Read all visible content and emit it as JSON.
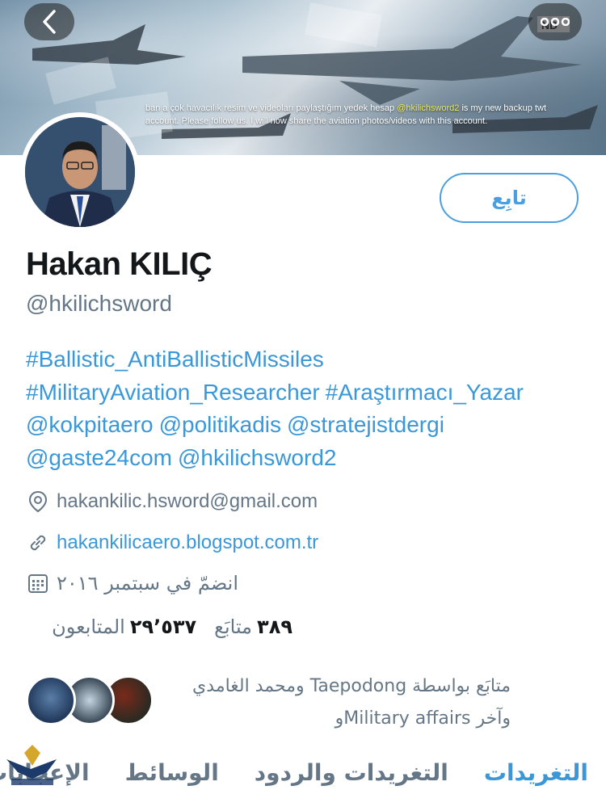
{
  "banner": {
    "text_part1": "ban a çok havacılık resim ve videoları paylaştığım yedek hesap ",
    "text_handle": "@hkilichsword2",
    "text_part2": " is my new backup twt account. Please follow us. I will now share the aviation photos/videos with this account.",
    "plate": "ND"
  },
  "nav": {
    "back_icon": "chevron-left-icon",
    "more_icon": "more-dots-icon"
  },
  "profile": {
    "follow_label": "تابِع",
    "name": "Hakan KILIÇ",
    "handle": "@hkilichsword",
    "bio_tags": [
      "#Ballistic_AntiBallisticMissiles",
      "#MilitaryAviation_Researcher",
      "#Araştırmacı_Yazar",
      "@kokpitaero",
      "@politikadis",
      "@stratejistdergi",
      "@gaste24com",
      "@hkilichsword2"
    ],
    "location": "hakankilic.hsword@gmail.com",
    "website": "hakankilicaero.blogspot.com.tr",
    "joined": "انضمّ في سبتمبر ٢٠١٦"
  },
  "stats": {
    "following_count": "٣٨٩",
    "following_label": "متابَع",
    "followers_count": "٢٩٬٥٣٧",
    "followers_label": "المتابعون"
  },
  "followed_by": {
    "line1": "متابَع بواسطة Taepodong ومحمد الغامدي",
    "line2": "وآخر Military affairsو"
  },
  "tabs": [
    "التغريدات",
    "التغريدات والردود",
    "الوسائط",
    "الإعجابات"
  ],
  "colors": {
    "accent": "#3a98d8",
    "muted": "#657786"
  }
}
